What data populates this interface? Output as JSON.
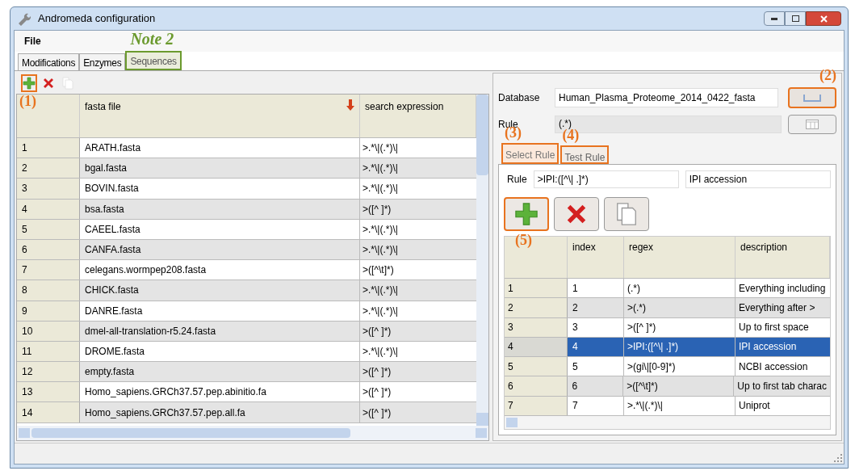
{
  "window": {
    "title": "Andromeda configuration"
  },
  "menu": [
    "File"
  ],
  "tabs": [
    {
      "label": "Modifications",
      "selected": false
    },
    {
      "label": "Enzymes",
      "selected": false
    },
    {
      "label": "Sequences",
      "selected": true,
      "callout": {
        "label": "Note 2",
        "color": "#6b9a2e"
      }
    }
  ],
  "toolbar": [
    {
      "kind": "add",
      "disabled": false,
      "callout": {
        "label": "(1)",
        "color": "#e8731f"
      }
    },
    {
      "kind": "delete",
      "disabled": false
    },
    {
      "kind": "copy",
      "disabled": true
    }
  ],
  "fasta_table": {
    "columns": [
      {
        "label": "fasta file",
        "sorted": true
      },
      {
        "label": "search expression",
        "sorted": false
      }
    ],
    "rows": [
      {
        "n": "1",
        "file": "ARATH.fasta",
        "expr": ">.*\\|(.*)\\|"
      },
      {
        "n": "2",
        "file": "bgal.fasta",
        "expr": ">.*\\|(.*)\\|"
      },
      {
        "n": "3",
        "file": "BOVIN.fasta",
        "expr": ">.*\\|(.*)\\|"
      },
      {
        "n": "4",
        "file": "bsa.fasta",
        "expr": ">([^ ]*)"
      },
      {
        "n": "5",
        "file": "CAEEL.fasta",
        "expr": ">.*\\|(.*)\\|"
      },
      {
        "n": "6",
        "file": "CANFA.fasta",
        "expr": ">.*\\|(.*)\\|"
      },
      {
        "n": "7",
        "file": "celegans.wormpep208.fasta",
        "expr": ">([^\\t]*)"
      },
      {
        "n": "8",
        "file": "CHICK.fasta",
        "expr": ">.*\\|(.*)\\|"
      },
      {
        "n": "9",
        "file": "DANRE.fasta",
        "expr": ">.*\\|(.*)\\|"
      },
      {
        "n": "10",
        "file": "dmel-all-translation-r5.24.fasta",
        "expr": ">([^ ]*)"
      },
      {
        "n": "11",
        "file": "DROME.fasta",
        "expr": ">.*\\|(.*)\\|"
      },
      {
        "n": "12",
        "file": "empty.fasta",
        "expr": ">([^ ]*)"
      },
      {
        "n": "13",
        "file": "Homo_sapiens.GRCh37.57.pep.abinitio.fa",
        "expr": ">([^ ]*)"
      },
      {
        "n": "14",
        "file": "Homo_sapiens.GRCh37.57.pep.all.fa",
        "expr": ">([^ ]*)"
      }
    ]
  },
  "database": {
    "label": "Database",
    "value": "Human_Plasma_Proteome_2014_0422_fasta",
    "button_callout": {
      "label": "(2)",
      "color": "#e8731f"
    }
  },
  "rule": {
    "label": "Rule",
    "value": "(.*)"
  },
  "rule_tabs": [
    {
      "label": "Select Rule",
      "selected": true,
      "callout": {
        "label": "(3)",
        "color": "#e8731f"
      }
    },
    {
      "label": "Test Rule",
      "selected": false,
      "callout": {
        "label": "(4)",
        "color": "#e8731f"
      }
    }
  ],
  "rule_edit": {
    "label": "Rule",
    "regex": ">IPI:([^\\| .]*)",
    "description": "IPI accession"
  },
  "rule_buttons": [
    {
      "kind": "add",
      "callout": {
        "label": "(5)",
        "color": "#e8731f"
      }
    },
    {
      "kind": "delete"
    },
    {
      "kind": "copy"
    }
  ],
  "rules_table": {
    "columns": [
      "index",
      "regex",
      "description"
    ],
    "rows": [
      {
        "n": "1",
        "index": "1",
        "regex": "(.*)",
        "description": "Everything including",
        "selected": false
      },
      {
        "n": "2",
        "index": "2",
        "regex": ">(.*)",
        "description": "Everything after >",
        "selected": false
      },
      {
        "n": "3",
        "index": "3",
        "regex": ">([^ ]*)",
        "description": "Up to first space",
        "selected": false
      },
      {
        "n": "4",
        "index": "4",
        "regex": ">IPI:([^\\| .]*)",
        "description": "IPI accession",
        "selected": true
      },
      {
        "n": "5",
        "index": "5",
        "regex": ">(gi\\|[0-9]*)",
        "description": "NCBI accession",
        "selected": false
      },
      {
        "n": "6",
        "index": "6",
        "regex": ">([^\\t]*)",
        "description": "Up to first tab charac",
        "selected": false
      },
      {
        "n": "7",
        "index": "7",
        "regex": ">.*\\|(.*)\\|",
        "description": "Uniprot",
        "selected": false
      }
    ]
  }
}
